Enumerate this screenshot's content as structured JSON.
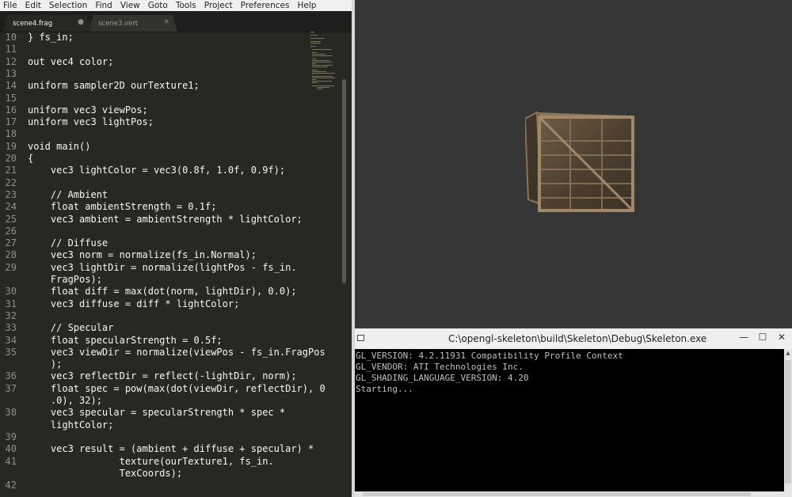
{
  "menu": [
    "File",
    "Edit",
    "Selection",
    "Find",
    "View",
    "Goto",
    "Tools",
    "Project",
    "Preferences",
    "Help"
  ],
  "tabs": [
    {
      "label": "scene4.frag",
      "button": "●"
    },
    {
      "label": "scene3.vert",
      "button": "×"
    }
  ],
  "code_lines": [
    {
      "num": "10",
      "text": "} fs_in;"
    },
    {
      "num": "11",
      "text": ""
    },
    {
      "num": "12",
      "text": "out vec4 color;"
    },
    {
      "num": "13",
      "text": ""
    },
    {
      "num": "14",
      "text": "uniform sampler2D ourTexture1;"
    },
    {
      "num": "15",
      "text": ""
    },
    {
      "num": "16",
      "text": "uniform vec3 viewPos;"
    },
    {
      "num": "17",
      "text": "uniform vec3 lightPos;"
    },
    {
      "num": "18",
      "text": ""
    },
    {
      "num": "19",
      "text": "void main()"
    },
    {
      "num": "20",
      "text": "{"
    },
    {
      "num": "21",
      "text": "    vec3 lightColor = vec3(0.8f, 1.0f, 0.9f);"
    },
    {
      "num": "22",
      "text": ""
    },
    {
      "num": "23",
      "text": "    // Ambient"
    },
    {
      "num": "24",
      "text": "    float ambientStrength = 0.1f;"
    },
    {
      "num": "25",
      "text": "    vec3 ambient = ambientStrength * lightColor;"
    },
    {
      "num": "26",
      "text": ""
    },
    {
      "num": "27",
      "text": "    // Diffuse"
    },
    {
      "num": "28",
      "text": "    vec3 norm = normalize(fs_in.Normal);"
    },
    {
      "num": "29",
      "text": "    vec3 lightDir = normalize(lightPos - fs_in."
    },
    {
      "num": "",
      "text": "    FragPos);"
    },
    {
      "num": "30",
      "text": "    float diff = max(dot(norm, lightDir), 0.0);"
    },
    {
      "num": "31",
      "text": "    vec3 diffuse = diff * lightColor;"
    },
    {
      "num": "32",
      "text": ""
    },
    {
      "num": "33",
      "text": "    // Specular"
    },
    {
      "num": "34",
      "text": "    float specularStrength = 0.5f;"
    },
    {
      "num": "35",
      "text": "    vec3 viewDir = normalize(viewPos - fs_in.FragPos"
    },
    {
      "num": "",
      "text": "    );"
    },
    {
      "num": "36",
      "text": "    vec3 reflectDir = reflect(-lightDir, norm);"
    },
    {
      "num": "37",
      "text": "    float spec = pow(max(dot(viewDir, reflectDir), 0"
    },
    {
      "num": "",
      "text": "    .0), 32);"
    },
    {
      "num": "38",
      "text": "    vec3 specular = specularStrength * spec *"
    },
    {
      "num": "",
      "text": "    lightColor;"
    },
    {
      "num": "39",
      "text": ""
    },
    {
      "num": "40",
      "text": "    vec3 result = (ambient + diffuse + specular) *"
    },
    {
      "num": "41",
      "text": "                texture(ourTexture1, fs_in."
    },
    {
      "num": "",
      "text": "                TexCoords);"
    },
    {
      "num": "42",
      "text": ""
    }
  ],
  "console": {
    "title": "C:\\opengl-skeleton\\build\\Skeleton\\Debug\\Skeleton.exe",
    "minimize": "—",
    "maximize": "☐",
    "close": "✕",
    "lines": [
      "GL_VERSION: 4.2.11931 Compatibility Profile Context",
      "GL_VENDOR: ATI Technologies Inc.",
      "GL_SHADING_LANGUAGE_VERSION: 4.20",
      "Starting..."
    ]
  },
  "colors": {
    "editor_bg": "#272822",
    "viewport_bg": "#363636",
    "console_bg": "#000000",
    "code_text": "#f8f8f2"
  }
}
